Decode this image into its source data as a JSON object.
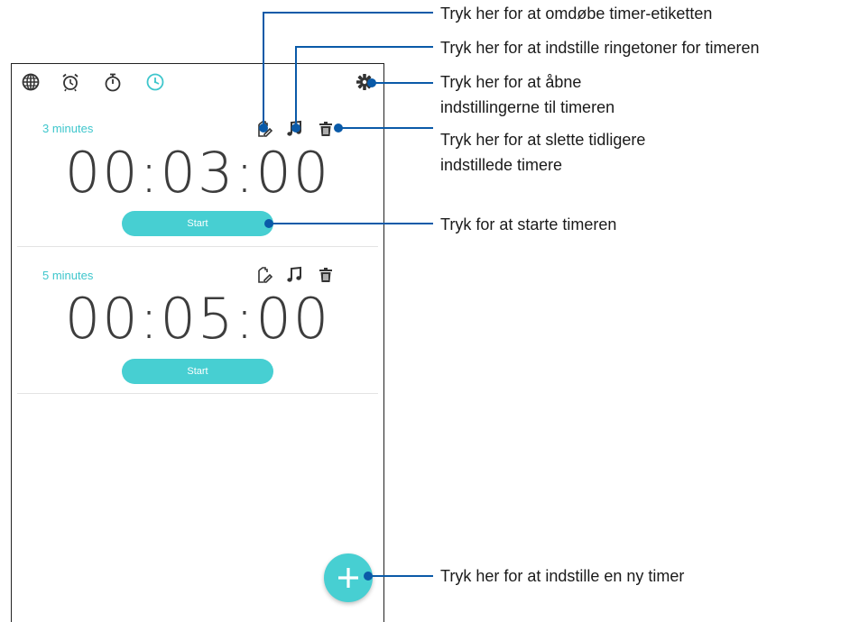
{
  "tabs": [
    {
      "name": "world-clock",
      "active": false
    },
    {
      "name": "alarm",
      "active": false
    },
    {
      "name": "stopwatch",
      "active": false
    },
    {
      "name": "timer",
      "active": true
    }
  ],
  "accent_color": "#47cfd2",
  "icon_color": "#333333",
  "timers": [
    {
      "label": "3 minutes",
      "time": "00:03:00",
      "start_label": "Start"
    },
    {
      "label": "5 minutes",
      "time": "00:05:00",
      "start_label": "Start"
    }
  ],
  "annotations": {
    "rename_label": "Tryk her for at omdøbe timer-etiketten",
    "ringtone": "Tryk her for at indstille ringetoner for timeren",
    "settings_line1": "Tryk her for at åbne",
    "settings_line2": "indstillingerne til timeren",
    "delete_line1": "Tryk her for at slette tidligere",
    "delete_line2": "indstillede timere",
    "start": "Tryk for at starte timeren",
    "new_timer": "Tryk her for at indstille en ny timer"
  },
  "callout_color": "#0a5aa8"
}
